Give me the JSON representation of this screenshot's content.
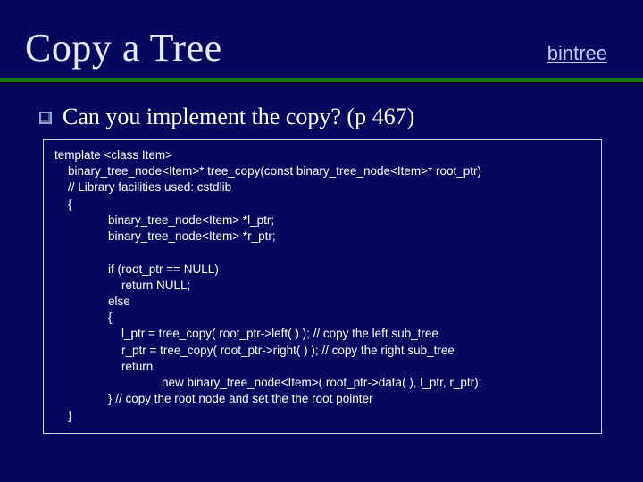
{
  "title": "Copy a Tree",
  "link_label": "bintree",
  "bullet": "Can you implement the copy?  (p 467)",
  "code_lines": [
    "template <class Item>",
    "    binary_tree_node<Item>* tree_copy(const binary_tree_node<Item>* root_ptr)",
    "    // Library facilities used: cstdlib",
    "    {",
    "                binary_tree_node<Item> *l_ptr;",
    "                binary_tree_node<Item> *r_ptr;",
    "",
    "                if (root_ptr == NULL)",
    "                    return NULL;",
    "                else",
    "                {",
    "                    l_ptr = tree_copy( root_ptr->left( ) ); // copy the left sub_tree",
    "                    r_ptr = tree_copy( root_ptr->right( ) ); // copy the right sub_tree",
    "                    return",
    "                                new binary_tree_node<Item>( root_ptr->data( ), l_ptr, r_ptr);",
    "                } // copy the root node and set the the root pointer",
    "    }"
  ]
}
